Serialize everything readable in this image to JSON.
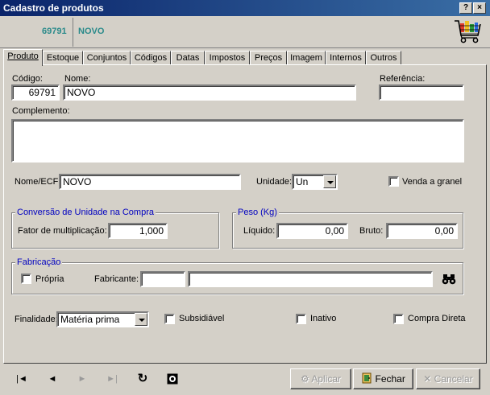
{
  "window": {
    "title": "Cadastro de produtos",
    "help_label": "?",
    "close_label": "×"
  },
  "header": {
    "code": "69791",
    "name": "NOVO"
  },
  "tabs": [
    "Produto",
    "Estoque",
    "Conjuntos",
    "Códigos",
    "Datas",
    "Impostos",
    "Preços",
    "Imagem",
    "Internos",
    "Outros"
  ],
  "form": {
    "codigo_label": "Código:",
    "codigo_value": "69791",
    "nome_label": "Nome:",
    "nome_value": "NOVO",
    "referencia_label": "Referência:",
    "referencia_value": "",
    "complemento_label": "Complemento:",
    "complemento_value": "",
    "nome_ecf_label": "Nome/ECF:",
    "nome_ecf_value": "NOVO",
    "unidade_label": "Unidade:",
    "unidade_value": "Un",
    "granel_label": "Venda a granel",
    "conversao_title": "Conversão de Unidade na Compra",
    "fator_label": "Fator de multiplicação:",
    "fator_value": "1,000",
    "peso_title": "Peso (Kg)",
    "liquido_label": "Líquido:",
    "liquido_value": "0,00",
    "bruto_label": "Bruto:",
    "bruto_value": "0,00",
    "fabricacao_title": "Fabricação",
    "propria_label": "Própria",
    "fabricante_label": "Fabricante:",
    "fabricante_code": "",
    "fabricante_name": "",
    "finalidade_label": "Finalidade:",
    "finalidade_value": "Matéria prima",
    "subsidiavel_label": "Subsidiável",
    "inativo_label": "Inativo",
    "compra_direta_label": "Compra Direta"
  },
  "buttons": {
    "aplicar": "Aplicar",
    "fechar": "Fechar",
    "cancelar": "Cancelar"
  },
  "colors": {
    "title_bar": "#0a246a",
    "header_text": "#2a8a8a",
    "group_title": "#0000c0"
  }
}
